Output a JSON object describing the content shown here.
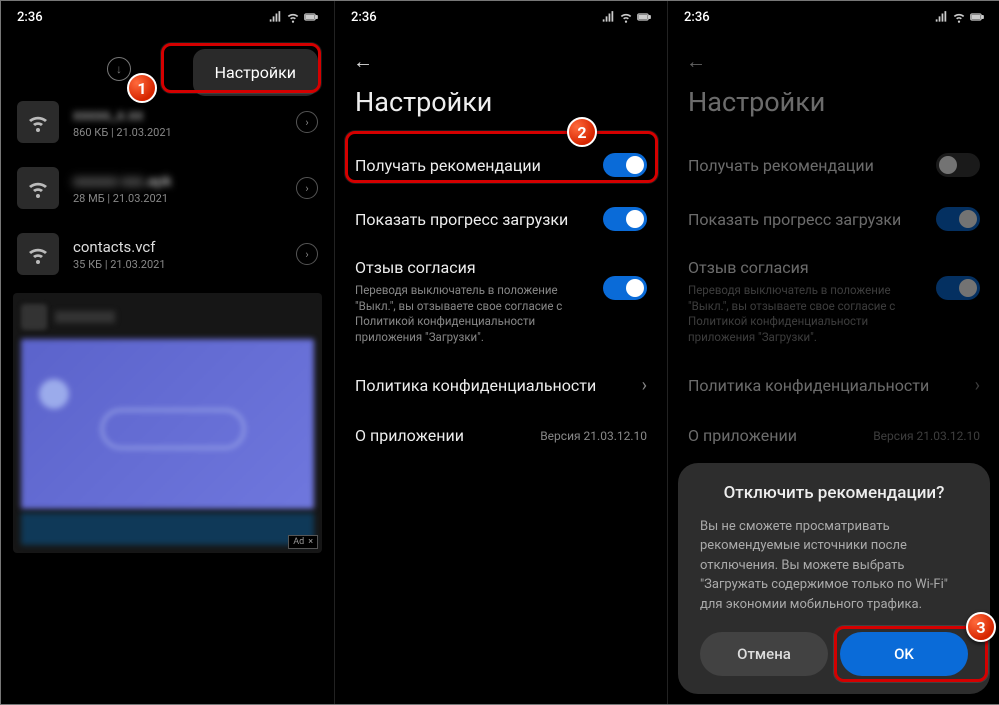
{
  "status": {
    "time": "2:36"
  },
  "screen1": {
    "menu_label": "Настройки",
    "files": [
      {
        "name": "xxxxx_x.xx",
        "sub": "860 КБ | 21.03.2021",
        "blur": true
      },
      {
        "name": "xxxxx_xxx.apk",
        "sub": "28 МБ | 21.03.2021",
        "blur": false,
        "suffix": ".apk"
      },
      {
        "name": "contacts.vcf",
        "sub": "35 КБ | 21.03.2021",
        "blur": false
      }
    ],
    "ad_label": "Ad",
    "ad_close": "×"
  },
  "settings": {
    "title": "Настройки",
    "recommend": "Получать рекомендации",
    "progress": "Показать прогресс загрузки",
    "consent_title": "Отзыв согласия",
    "consent_desc": "Переводя выключатель в положение \"Выкл.\", вы отзываете свое согласие с Политикой конфиденциальности приложения \"Загрузки\".",
    "privacy": "Политика конфиденциальности",
    "about": "О приложении",
    "version": "Версия 21.03.12.10"
  },
  "dialog": {
    "title": "Отключить рекомендации?",
    "body": "Вы не сможете просматривать рекомендуемые источники после отключения. Вы можете выбрать \"Загружать содержимое только по Wi-Fi\" для экономии мобильного трафика.",
    "cancel": "Отмена",
    "ok": "OK"
  },
  "badges": {
    "b1": "1",
    "b2": "2",
    "b3": "3"
  }
}
